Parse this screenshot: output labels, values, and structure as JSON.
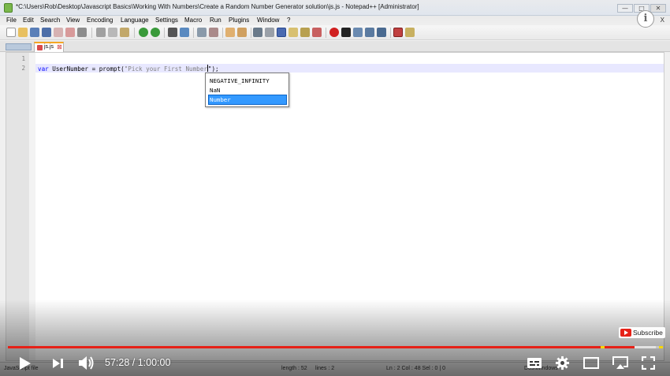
{
  "window": {
    "title": "*C:\\Users\\Rob\\Desktop\\Javascript Basics\\Working With Numbers\\Create a Random Number Generator solution\\js.js - Notepad++ [Administrator]",
    "controls": {
      "minimize": "—",
      "maximize": "□",
      "close": "✕"
    }
  },
  "menu": {
    "items": [
      "File",
      "Edit",
      "Search",
      "View",
      "Encoding",
      "Language",
      "Settings",
      "Macro",
      "Run",
      "Plugins",
      "Window",
      "?"
    ],
    "close_label": "X"
  },
  "tab": {
    "label": "js.js",
    "close": "⊠"
  },
  "editor": {
    "line_numbers": [
      "1",
      "2"
    ],
    "line2": {
      "keyword": "var",
      "before_string": " UserNumber = prompt(",
      "string_typed": "\"Pick your First Number",
      "after_caret": "\");"
    }
  },
  "autocomplete": {
    "items": [
      "NEGATIVE_INFINITY",
      "NaN",
      "Number"
    ],
    "selected_index": 2
  },
  "statusbar": {
    "file_type": "JavaScript file",
    "length": "length : 52",
    "lines": "lines : 2",
    "position": "Ln : 2    Col : 48    Sel : 0 | 0",
    "eol": "Dos\\Windows"
  },
  "player": {
    "time": "57:28 / 1:00:00",
    "progress": 0.958,
    "buffered": 0.99,
    "subscribe_label": "Subscribe",
    "info_label": "i",
    "icons": [
      "play-icon",
      "next-icon",
      "volume-icon",
      "subtitles-icon",
      "settings-gear-icon",
      "miniplayer-icon",
      "theater-mode-icon",
      "fullscreen-icon"
    ]
  },
  "colors": {
    "accent_red": "#e62117",
    "keyword_blue": "#0000ff",
    "selection_blue": "#3399ff"
  }
}
